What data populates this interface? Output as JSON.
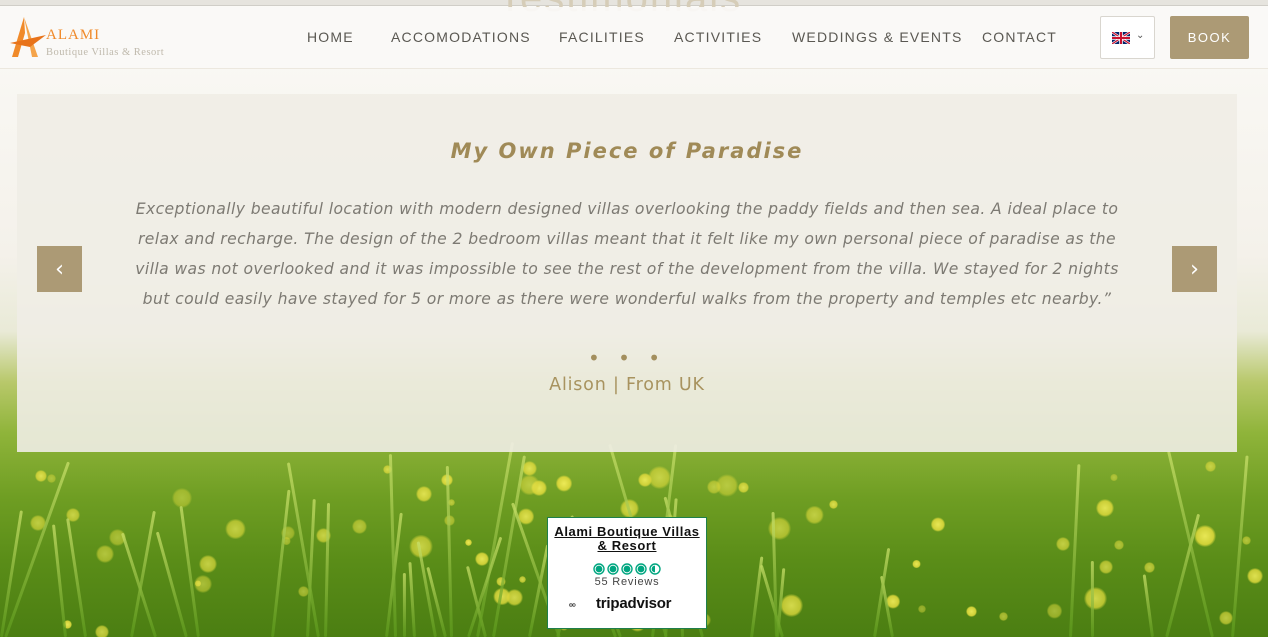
{
  "background": {
    "ghost_title": "Testimonials"
  },
  "brand": {
    "name": "ALAMI",
    "tagline": "Boutique Villas & Resort",
    "accent": "#f08a2a"
  },
  "nav": {
    "items": [
      {
        "label": "HOME"
      },
      {
        "label": "ACCOMODATIONS"
      },
      {
        "label": "FACILITIES"
      },
      {
        "label": "ACTIVITIES"
      },
      {
        "label": "WEDDINGS & EVENTS"
      },
      {
        "label": "CONTACT"
      }
    ],
    "language": {
      "flag_icon": "uk-flag-icon",
      "caret": "⌄"
    },
    "book_label": "BOOK",
    "book_color": "#ac9a75"
  },
  "testimonial": {
    "title": "My Own Piece of Paradise",
    "body": "Exceptionally beautiful location with modern designed villas overlooking the paddy fields and then sea. A ideal place to relax and recharge. The design of the 2 bedroom villas meant that it felt like my own personal piece of paradise as the villa was not overlooked and it was impossible to see the rest of the development from the villa. We stayed for 2 nights but could easily have stayed for 5 or more as there were wonderful walks from the property and temples etc nearby.”",
    "dots": "• • •",
    "author": "Alison | From UK",
    "prev_icon": "‹",
    "next_icon": "›"
  },
  "tripadvisor": {
    "name": "Alami Boutique Villas & Resort",
    "rating": 4.5,
    "reviews": "55 Reviews",
    "brand": "tripadvisor",
    "brand_color": "#00a680"
  }
}
